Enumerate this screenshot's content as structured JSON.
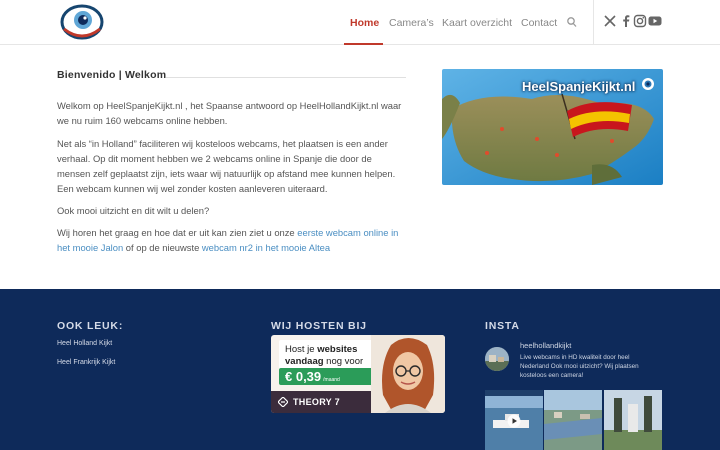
{
  "header": {
    "nav": [
      {
        "label": "Home",
        "active": true
      },
      {
        "label": "Camera’s",
        "active": false
      },
      {
        "label": "Kaart overzicht",
        "active": false
      },
      {
        "label": "Contact",
        "active": false
      }
    ],
    "icons": [
      "search-icon",
      "x-icon",
      "facebook-icon",
      "instagram-icon",
      "youtube-icon"
    ]
  },
  "main": {
    "title": "Bienvenido | Welkom",
    "p1": "Welkom op HeelSpanjeKijkt.nl , het Spaanse antwoord op HeelHollandKijkt.nl waar we nu ruim 160 webcams online hebben.",
    "p2": "Net als “in Holland” faciliteren wij kosteloos webcams, het plaatsen is een ander verhaal. Op dit moment hebben we 2 webcams online in Spanje die door de mensen zelf geplaatst zijn, iets waar wij natuurlijk op afstand mee kunnen helpen. Een webcam kunnen wij wel zonder kosten aanleveren uiteraard.",
    "p3": "Ook mooi uitzicht en dit wilt u delen?",
    "p4_pre": "Wij horen het graag en hoe dat er uit kan zien ziet u onze ",
    "p4_link1": "eerste webcam online in het mooie Jalon",
    "p4_mid": " of op de nieuwste ",
    "p4_link2": "webcam nr2 in het mooie Altea",
    "hero_text": "HeelSpanjeKijkt.nl"
  },
  "footer": {
    "col1_title": "OOK LEUK:",
    "col1_links": [
      "Heel Holland Kijkt",
      "Heel Frankrijk Kijkt"
    ],
    "col2_title": "WIJ HOSTEN BIJ",
    "ad": {
      "line1": "Host je ",
      "line1_bold": "websites",
      "line2_bold": "vandaag",
      "line2": " nog voor",
      "price": "€ 0,39",
      "price_unit": "/maand",
      "brand": "THEORY 7"
    },
    "col3_title": "INSTA",
    "insta_user": "heelhollandkijkt",
    "insta_bio": "Live webcams in HD kwaliteit door heel Nederland Ook mooi uitzicht? Wij plaatsen kosteloos een camera!"
  },
  "colors": {
    "accent": "#c0392b",
    "link": "#4a8ec2",
    "footer_bg": "#0e2a5a"
  }
}
